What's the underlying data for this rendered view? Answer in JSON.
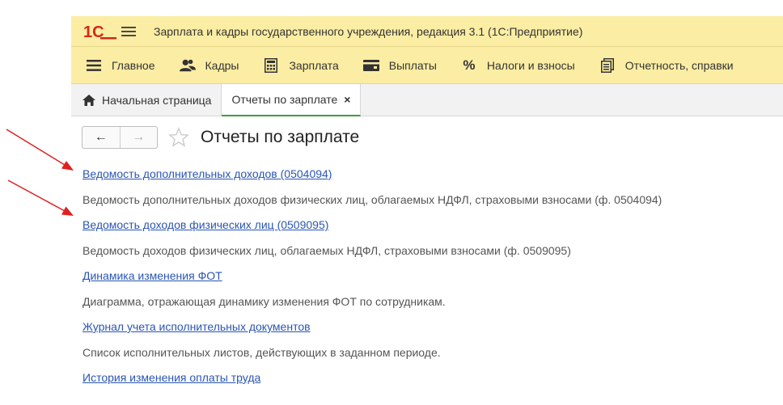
{
  "window": {
    "logo_text": "1С",
    "title": "Зарплата и кадры государственного учреждения, редакция 3.1  (1С:Предприятие)"
  },
  "sections": [
    {
      "label": "Главное",
      "icon": "menu-lines-icon"
    },
    {
      "label": "Кадры",
      "icon": "people-icon"
    },
    {
      "label": "Зарплата",
      "icon": "calculator-icon"
    },
    {
      "label": "Выплаты",
      "icon": "wallet-icon"
    },
    {
      "label": "Налоги и взносы",
      "icon": "percent-icon",
      "icon_text": "%"
    },
    {
      "label": "Отчетность, справки",
      "icon": "reports-icon"
    }
  ],
  "tabs": [
    {
      "label": "Начальная страница",
      "icon": "home-icon"
    },
    {
      "label": "Отчеты по зарплате",
      "close": "×"
    }
  ],
  "header": {
    "back_glyph": "←",
    "forward_glyph": "→",
    "title": "Отчеты по зарплате"
  },
  "reports": [
    {
      "link": "Ведомость дополнительных доходов (0504094)",
      "description": "Ведомость дополнительных доходов физических лиц, облагаемых НДФЛ, страховыми взносами (ф. 0504094)"
    },
    {
      "link": "Ведомость доходов физических лиц (0509095)",
      "description": "Ведомость доходов физических лиц, облагаемых НДФЛ, страховыми взносами (ф. 0509095)"
    },
    {
      "link": "Динамика изменения ФОТ",
      "description": "Диаграмма, отражающая динамику изменения ФОТ по сотрудникам."
    },
    {
      "link": "Журнал учета исполнительных документов",
      "description": "Список исполнительных листов, действующих в заданном периоде."
    },
    {
      "link": "История изменения оплаты труда",
      "description": ""
    }
  ],
  "colors": {
    "panel_yellow": "#fbeda3",
    "link_blue": "#2a55b4",
    "active_tab_green": "#3c9e3c",
    "logo_red": "#d4281c",
    "annotation_red": "#e02020"
  }
}
